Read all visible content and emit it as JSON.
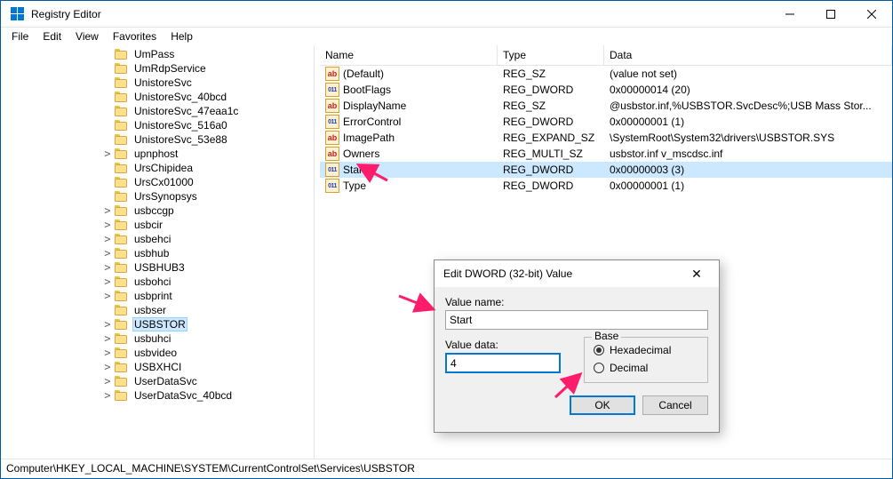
{
  "window": {
    "title": "Registry Editor"
  },
  "menu": [
    "File",
    "Edit",
    "View",
    "Favorites",
    "Help"
  ],
  "tree": {
    "items": [
      {
        "d": 7,
        "exp": "",
        "l": "UmPass"
      },
      {
        "d": 7,
        "exp": "",
        "l": "UmRdpService"
      },
      {
        "d": 7,
        "exp": "",
        "l": "UnistoreSvc"
      },
      {
        "d": 7,
        "exp": "",
        "l": "UnistoreSvc_40bcd"
      },
      {
        "d": 7,
        "exp": "",
        "l": "UnistoreSvc_47eaa1c"
      },
      {
        "d": 7,
        "exp": "",
        "l": "UnistoreSvc_516a0"
      },
      {
        "d": 7,
        "exp": "",
        "l": "UnistoreSvc_53e88"
      },
      {
        "d": 7,
        "exp": ">",
        "l": "upnphost"
      },
      {
        "d": 7,
        "exp": "",
        "l": "UrsChipidea"
      },
      {
        "d": 7,
        "exp": "",
        "l": "UrsCx01000"
      },
      {
        "d": 7,
        "exp": "",
        "l": "UrsSynopsys"
      },
      {
        "d": 7,
        "exp": ">",
        "l": "usbccgp"
      },
      {
        "d": 7,
        "exp": ">",
        "l": "usbcir"
      },
      {
        "d": 7,
        "exp": ">",
        "l": "usbehci"
      },
      {
        "d": 7,
        "exp": ">",
        "l": "usbhub"
      },
      {
        "d": 7,
        "exp": ">",
        "l": "USBHUB3"
      },
      {
        "d": 7,
        "exp": ">",
        "l": "usbohci"
      },
      {
        "d": 7,
        "exp": ">",
        "l": "usbprint"
      },
      {
        "d": 7,
        "exp": "",
        "l": "usbser"
      },
      {
        "d": 7,
        "exp": ">",
        "l": "USBSTOR",
        "sel": true
      },
      {
        "d": 7,
        "exp": ">",
        "l": "usbuhci"
      },
      {
        "d": 7,
        "exp": ">",
        "l": "usbvideo"
      },
      {
        "d": 7,
        "exp": ">",
        "l": "USBXHCI"
      },
      {
        "d": 7,
        "exp": ">",
        "l": "UserDataSvc"
      },
      {
        "d": 7,
        "exp": ">",
        "l": "UserDataSvc_40bcd"
      }
    ]
  },
  "columns": {
    "name": "Name",
    "type": "Type",
    "data": "Data"
  },
  "values": [
    {
      "icon": "str",
      "name": "(Default)",
      "type": "REG_SZ",
      "data": "(value not set)"
    },
    {
      "icon": "dw",
      "name": "BootFlags",
      "type": "REG_DWORD",
      "data": "0x00000014 (20)"
    },
    {
      "icon": "str",
      "name": "DisplayName",
      "type": "REG_SZ",
      "data": "@usbstor.inf,%USBSTOR.SvcDesc%;USB Mass Stor..."
    },
    {
      "icon": "dw",
      "name": "ErrorControl",
      "type": "REG_DWORD",
      "data": "0x00000001 (1)"
    },
    {
      "icon": "str",
      "name": "ImagePath",
      "type": "REG_EXPAND_SZ",
      "data": "\\SystemRoot\\System32\\drivers\\USBSTOR.SYS"
    },
    {
      "icon": "str",
      "name": "Owners",
      "type": "REG_MULTI_SZ",
      "data": "usbstor.inf v_mscdsc.inf"
    },
    {
      "icon": "dw",
      "name": "Start",
      "type": "REG_DWORD",
      "data": "0x00000003 (3)",
      "sel": true
    },
    {
      "icon": "dw",
      "name": "Type",
      "type": "REG_DWORD",
      "data": "0x00000001 (1)"
    }
  ],
  "status": "Computer\\HKEY_LOCAL_MACHINE\\SYSTEM\\CurrentControlSet\\Services\\USBSTOR",
  "dialog": {
    "title": "Edit DWORD (32-bit) Value",
    "value_name_label": "Value name:",
    "value_name": "Start",
    "value_data_label": "Value data:",
    "value_data": "4",
    "base_label": "Base",
    "radio_hex": "Hexadecimal",
    "radio_dec": "Decimal",
    "ok": "OK",
    "cancel": "Cancel"
  }
}
